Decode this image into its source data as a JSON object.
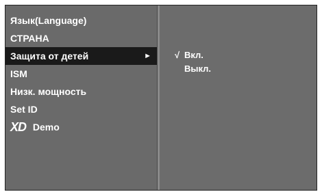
{
  "menu": {
    "items": [
      {
        "label": "Язык(Language)"
      },
      {
        "label": "СТРАНА"
      },
      {
        "label": "Защита от детей",
        "arrow": "►"
      },
      {
        "label": "ISM"
      },
      {
        "label": "Низк. мощность"
      },
      {
        "label": "Set ID"
      },
      {
        "logo": "XD",
        "label": "Demo"
      }
    ]
  },
  "submenu": {
    "check_mark": "√",
    "options": [
      {
        "label": "Вкл.",
        "selected": true
      },
      {
        "label": "Выкл.",
        "selected": false
      }
    ]
  }
}
